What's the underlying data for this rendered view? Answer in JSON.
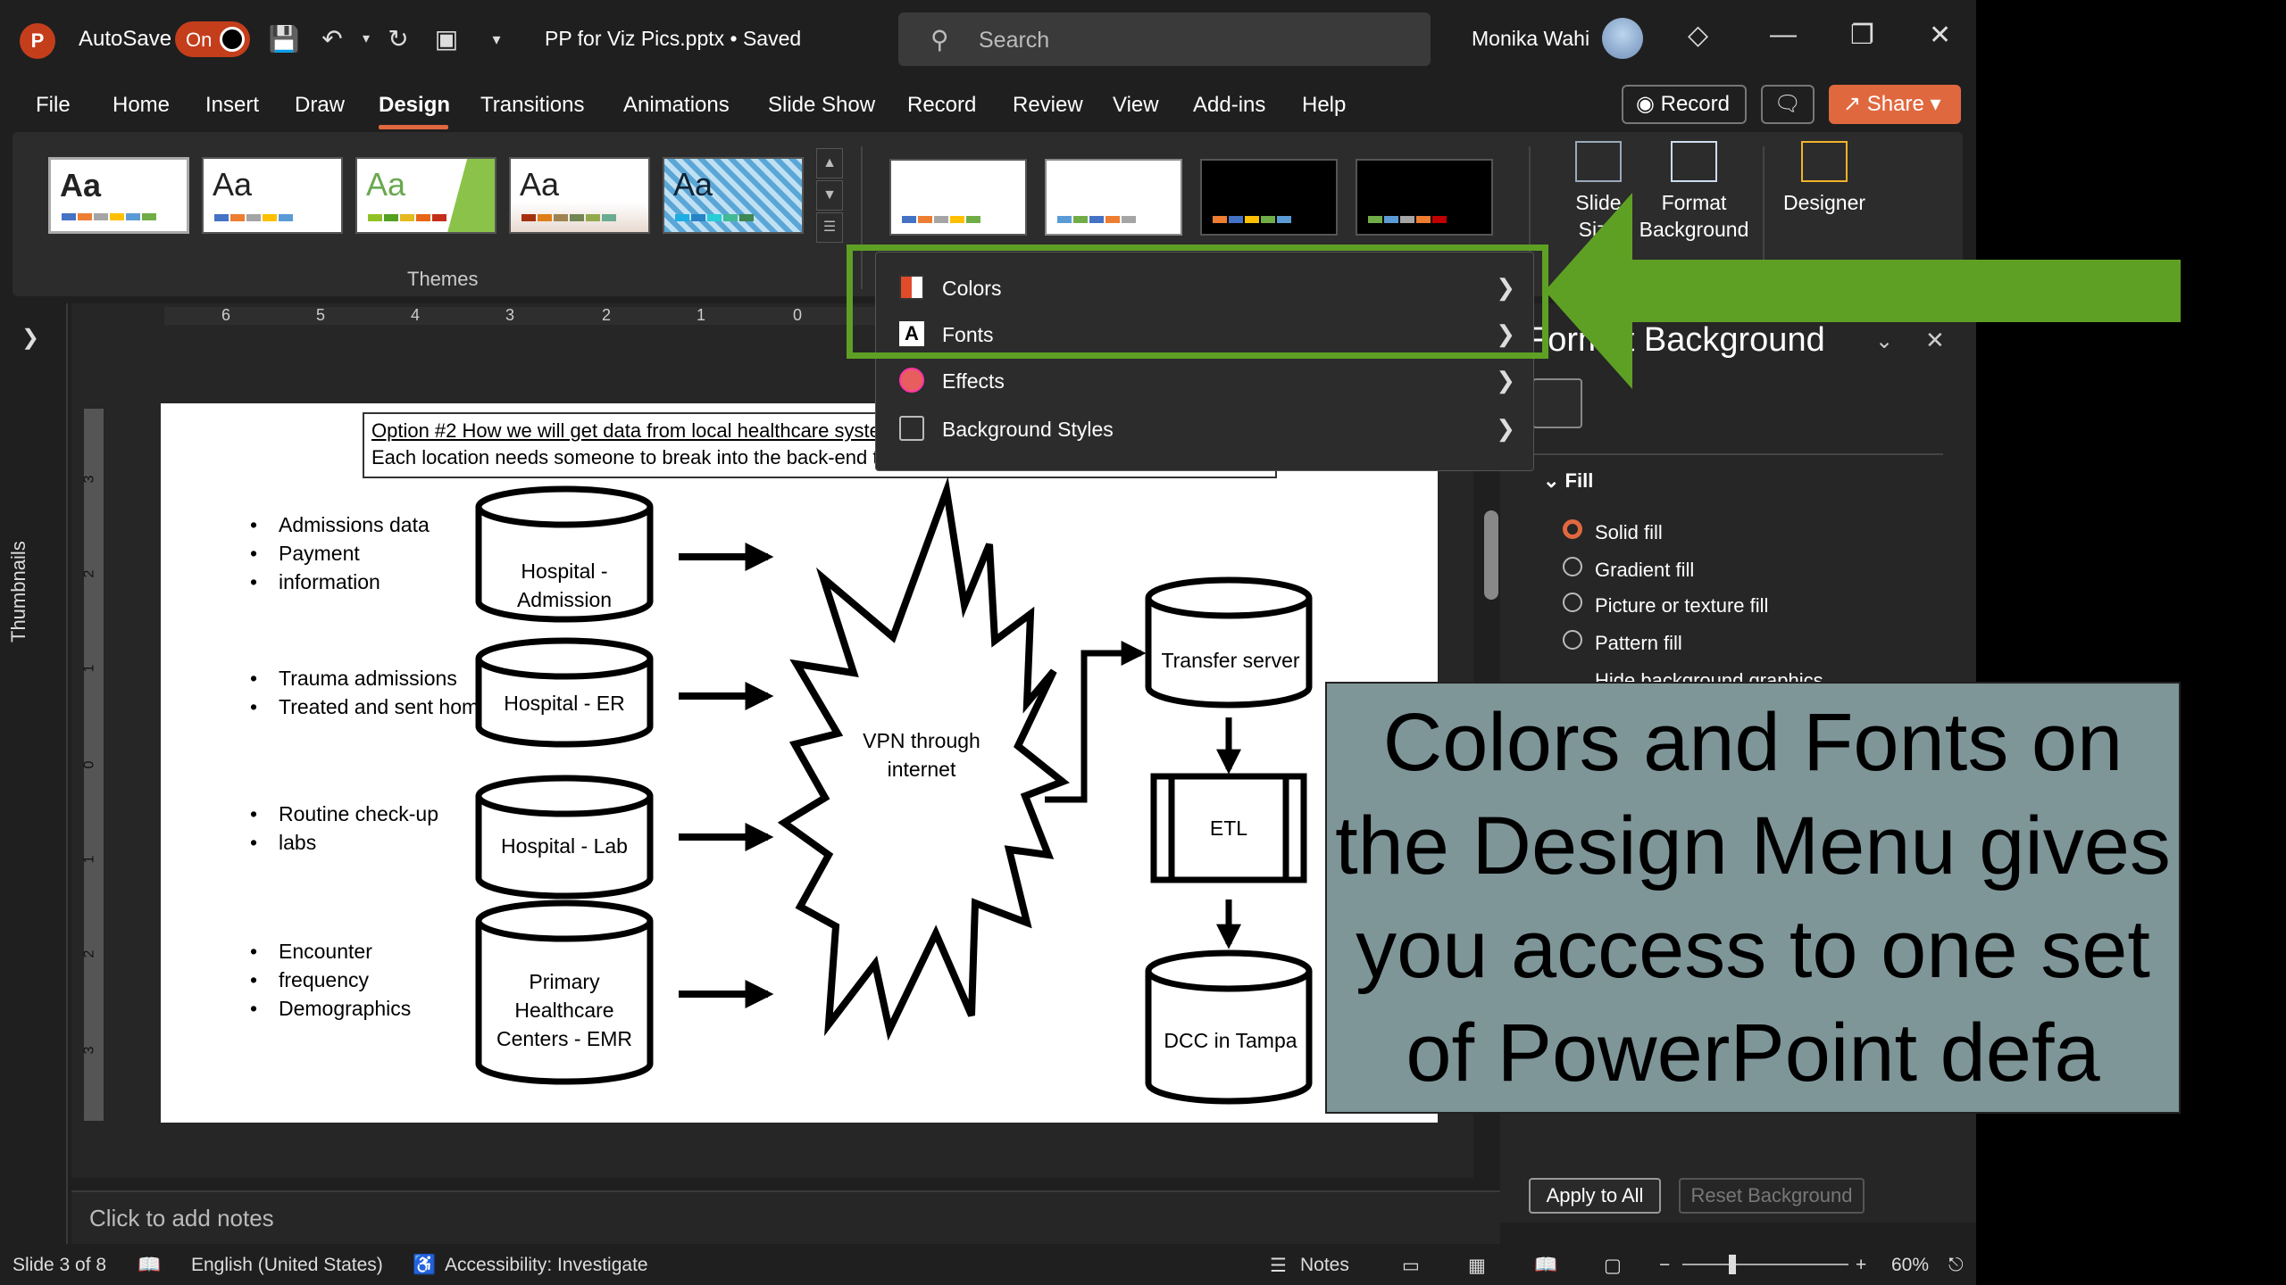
{
  "titlebar": {
    "autosave_label": "AutoSave",
    "autosave_state": "On",
    "doc_title": "PP for Viz Pics.pptx • Saved",
    "search_placeholder": "Search",
    "user_name": "Monika Wahi"
  },
  "menu": {
    "tabs": [
      "File",
      "Home",
      "Insert",
      "Draw",
      "Design",
      "Transitions",
      "Animations",
      "Slide Show",
      "Record",
      "Review",
      "View",
      "Add-ins",
      "Help"
    ],
    "active_tab": "Design",
    "record_label": "Record",
    "share_label": "Share"
  },
  "ribbon": {
    "themes_label": "Themes",
    "theme_preview_text": "Aa",
    "slide_size_label": "Slide Size",
    "format_background_label": "Format Background",
    "designer_label": "Designer"
  },
  "dropdown": {
    "items": [
      {
        "label": "Colors",
        "icon": "color-palette-icon"
      },
      {
        "label": "Fonts",
        "icon": "font-icon"
      },
      {
        "label": "Effects",
        "icon": "effects-icon"
      },
      {
        "label": "Background Styles",
        "icon": "background-styles-icon"
      }
    ]
  },
  "sidebar": {
    "thumbnails_label": "Thumbnails"
  },
  "ruler": {
    "h_ticks": [
      "6",
      "5",
      "4",
      "3",
      "2",
      "1",
      "0"
    ],
    "v_ticks": [
      "3",
      "2",
      "1",
      "0",
      "1",
      "2",
      "3"
    ]
  },
  "slide": {
    "header_line1": "Option #2 How we will get data from local healthcare syste",
    "header_line2": "Each location needs someone to break into the back-end t",
    "bullet_groups": [
      [
        "Admissions data",
        "Payment",
        "information"
      ],
      [
        "Trauma admissions",
        "Treated and sent home"
      ],
      [
        "Routine check-up",
        "labs"
      ],
      [
        "Encounter",
        "frequency",
        "Demographics"
      ]
    ],
    "sources": [
      "Hospital - Admission",
      "Hospital - ER",
      "Hospital - Lab",
      "Primary Healthcare Centers - EMR"
    ],
    "vpn_label": "VPN through internet",
    "transfer_label": "Transfer server",
    "etl_label": "ETL",
    "dcc_label": "DCC in Tampa"
  },
  "format_panel": {
    "title": "Format Background",
    "fill_header": "Fill",
    "options": [
      "Solid fill",
      "Gradient fill",
      "Picture or texture fill",
      "Pattern fill",
      "Hide background graphics"
    ],
    "selected_option": "Solid fill",
    "apply_all_label": "Apply to All",
    "reset_label": "Reset Background"
  },
  "notes": {
    "placeholder": "Click to add notes"
  },
  "statusbar": {
    "slide_info": "Slide 3 of 8",
    "language": "English (United States)",
    "accessibility": "Accessibility: Investigate",
    "notes_label": "Notes",
    "zoom": "60%"
  },
  "callout": {
    "text": "Colors and Fonts on the Design Menu gives you access to one set of PowerPoint defa"
  },
  "colors": {
    "accent": "#e0683f",
    "highlight_green": "#5ea024",
    "callout_bg": "#7f9699"
  }
}
